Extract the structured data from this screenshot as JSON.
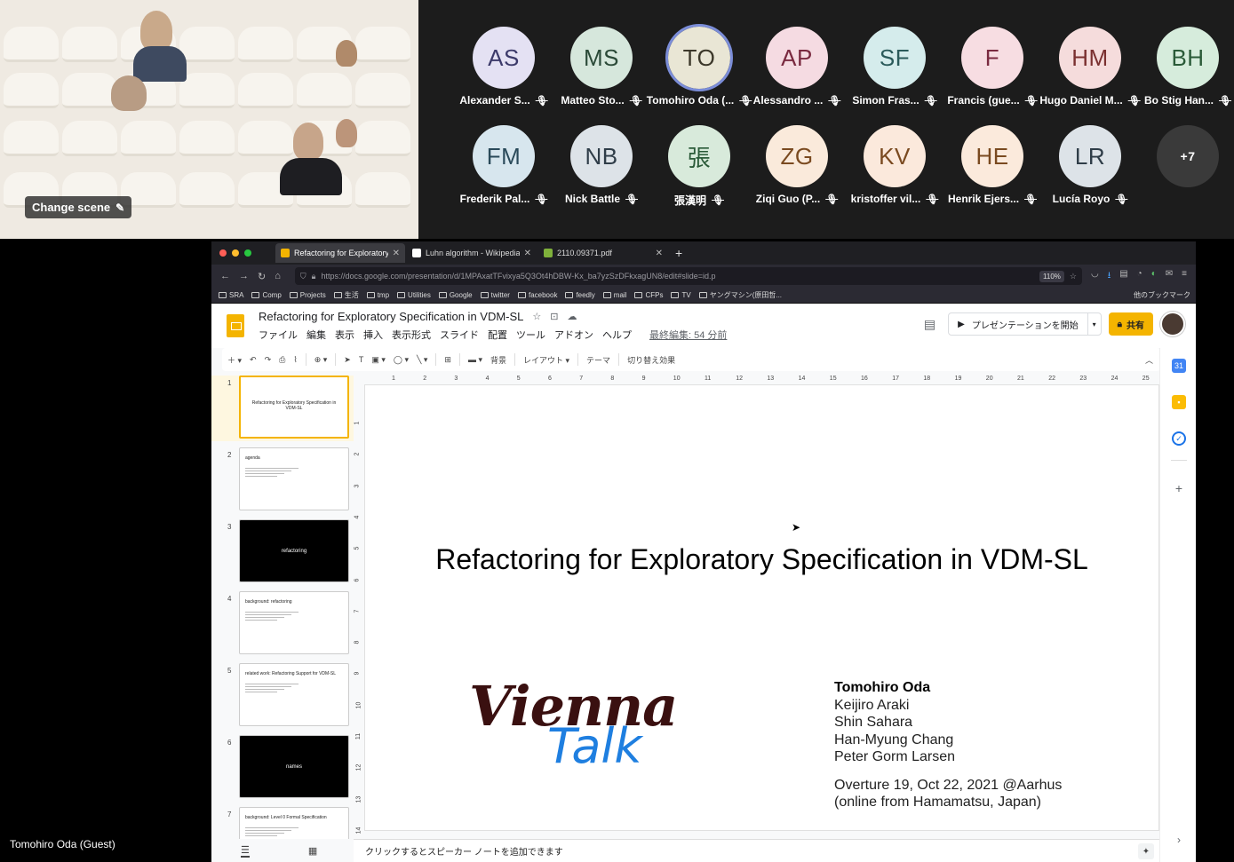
{
  "video": {
    "change_scene_label": "Change scene",
    "self_label": "Tomohiro Oda (Guest)"
  },
  "participants": [
    {
      "initials": "AS",
      "name": "Alexander S...",
      "bg": "#e4e1f3",
      "fg": "#3c3a6a"
    },
    {
      "initials": "MS",
      "name": "Matteo Sto...",
      "bg": "#d6e7dc",
      "fg": "#2b4a38"
    },
    {
      "initials": "TO",
      "name": "Tomohiro Oda (...",
      "bg": "#e9e6d5",
      "fg": "#3c382a",
      "active": true
    },
    {
      "initials": "AP",
      "name": "Alessandro ...",
      "bg": "#f5dbe2",
      "fg": "#7a2a40"
    },
    {
      "initials": "SF",
      "name": "Simon Fras...",
      "bg": "#d5ecec",
      "fg": "#2a5a5a"
    },
    {
      "initials": "F",
      "name": "Francis (gue...",
      "bg": "#f7dde2",
      "fg": "#7a2a40"
    },
    {
      "initials": "HM",
      "name": "Hugo Daniel M...",
      "bg": "#f5dcdc",
      "fg": "#7a3030"
    },
    {
      "initials": "BH",
      "name": "Bo Stig Han...",
      "bg": "#d6ecdc",
      "fg": "#2a5a38"
    },
    {
      "initials": "FM",
      "name": "Frederik Pal...",
      "bg": "#d7e6ee",
      "fg": "#2a4a5a"
    },
    {
      "initials": "NB",
      "name": "Nick Battle",
      "bg": "#dde3e8",
      "fg": "#2f3d48"
    },
    {
      "initials": "張",
      "name": "張漢明",
      "bg": "#d8eadb",
      "fg": "#2a5a38"
    },
    {
      "initials": "ZG",
      "name": "Ziqi Guo (P...",
      "bg": "#faeadb",
      "fg": "#7a4a20"
    },
    {
      "initials": "KV",
      "name": "kristoffer vil...",
      "bg": "#fbe9dc",
      "fg": "#7a4a20"
    },
    {
      "initials": "HE",
      "name": "Henrik Ejers...",
      "bg": "#fbeadc",
      "fg": "#7a4a20"
    },
    {
      "initials": "LR",
      "name": "Lucía Royo",
      "bg": "#dde3e8",
      "fg": "#2f3d48"
    },
    {
      "initials": "+7",
      "name": "",
      "more": true
    }
  ],
  "browser": {
    "tabs": [
      {
        "title": "Refactoring for Exploratory Spec",
        "fav": "#f4b400",
        "active": true
      },
      {
        "title": "Luhn algorithm - Wikipedia",
        "fav": "#ffffff",
        "active": false
      },
      {
        "title": "2110.09371.pdf",
        "fav": "#7fb13b",
        "active": false
      }
    ],
    "new_tab": "+",
    "url": "https://docs.google.com/presentation/d/1MPAxatTFvixya5Q3Ot4hDBW-Kx_ba7yzSzDFkxagUN8/edit#slide=id.p",
    "zoom": "110%",
    "bookmarks": [
      "SRA",
      "Comp",
      "Projects",
      "生活",
      "tmp",
      "Utilities",
      "Google",
      "twitter",
      "facebook",
      "feedly",
      "mail",
      "CFPs",
      "TV",
      "ヤングマシン(原田哲..."
    ],
    "other_bookmarks": "他のブックマーク"
  },
  "slides_app": {
    "doc_title": "Refactoring for Exploratory Specification in VDM-SL",
    "menus": [
      "ファイル",
      "編集",
      "表示",
      "挿入",
      "表示形式",
      "スライド",
      "配置",
      "ツール",
      "アドオン",
      "ヘルプ"
    ],
    "last_edit": "最終編集: 54 分前",
    "present_label": "プレゼンテーションを開始",
    "share_label": "共有",
    "toolbar": {
      "background": "背景",
      "layout": "レイアウト",
      "theme": "テーマ",
      "transition": "切り替え効果"
    },
    "thumbnails": [
      {
        "num": "1",
        "text": "Refactoring for Exploratory Specification in VDM-SL",
        "dark": false
      },
      {
        "num": "2",
        "text": "agenda",
        "dark": false
      },
      {
        "num": "3",
        "text": "refactoring",
        "dark": true
      },
      {
        "num": "4",
        "text": "background: refactoring",
        "dark": false
      },
      {
        "num": "5",
        "text": "related work: Refactoring Support for VDM-SL",
        "dark": false
      },
      {
        "num": "6",
        "text": "names",
        "dark": true
      },
      {
        "num": "7",
        "text": "background: Level 0 Formal Specification",
        "dark": false
      }
    ],
    "ruler_top": [
      "1",
      "2",
      "3",
      "4",
      "5",
      "6",
      "7",
      "8",
      "9",
      "10",
      "11",
      "12",
      "13",
      "14",
      "15",
      "16",
      "17",
      "18",
      "19",
      "20",
      "21",
      "22",
      "23",
      "24",
      "25"
    ],
    "ruler_left": [
      "1",
      "2",
      "3",
      "4",
      "5",
      "6",
      "7",
      "8",
      "9",
      "10",
      "11",
      "12",
      "13",
      "14"
    ],
    "slide": {
      "title": "Refactoring for Exploratory Specification in VDM-SL",
      "logo_top": "Vienna",
      "logo_bottom": "Talk",
      "authors": [
        "Tomohiro Oda",
        "Keijiro Araki",
        "Shin Sahara",
        "Han-Myung Chang",
        "Peter Gorm Larsen"
      ],
      "venue": "Overture 19, Oct 22, 2021 @Aarhus",
      "venue2": "(online from Hamamatsu, Japan)"
    },
    "notes_placeholder": "クリックするとスピーカー ノートを追加できます"
  }
}
